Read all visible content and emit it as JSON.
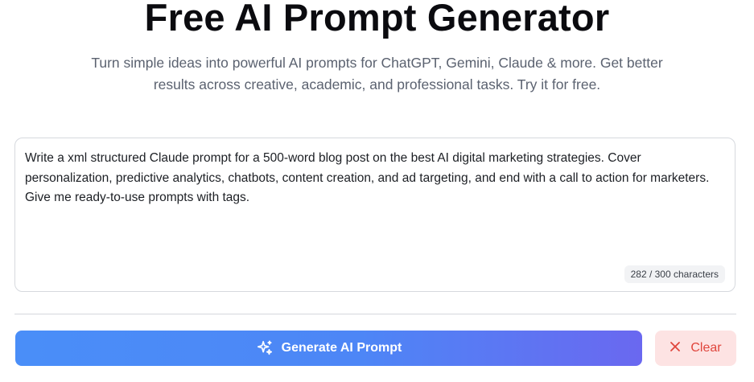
{
  "header": {
    "title": "Free AI Prompt Generator",
    "subtitle": "Turn simple ideas into powerful AI prompts for ChatGPT, Gemini, Claude & more. Get better results across creative, academic, and professional tasks. Try it for free."
  },
  "prompt_input": {
    "value": "Write a xml structured Claude prompt for a 500-word blog post on the best AI digital marketing strategies. Cover personalization, predictive analytics, chatbots, content creation, and ad targeting, and end with a call to action for marketers. Give me ready-to-use prompts with tags.",
    "char_count": "282 / 300 characters"
  },
  "actions": {
    "generate_label": "Generate AI Prompt",
    "generate_icon": "sparkles-icon",
    "clear_label": "Clear",
    "clear_icon": "close-icon"
  },
  "colors": {
    "generate_gradient_start": "#4a8ef8",
    "generate_gradient_end": "#6a68f0",
    "clear_bg": "#fde3e3",
    "clear_text": "#e0453c"
  }
}
